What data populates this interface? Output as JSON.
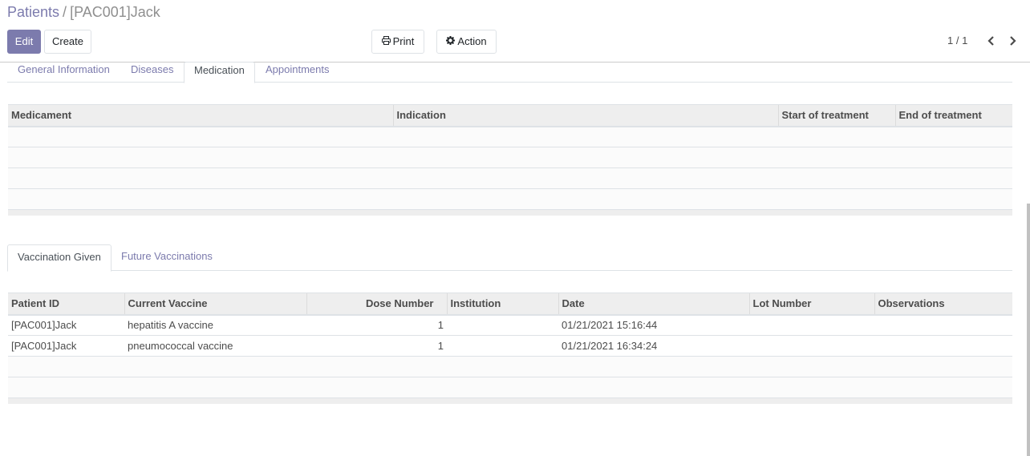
{
  "breadcrumb": {
    "parent": "Patients",
    "separator": "/",
    "current": "[PAC001]Jack"
  },
  "buttons": {
    "edit": "Edit",
    "create": "Create",
    "print": "Print",
    "action": "Action"
  },
  "pager": {
    "value": "1 / 1"
  },
  "icons": {
    "print": "print-icon",
    "action": "gear-icon",
    "prev": "chevron-left-icon",
    "next": "chevron-right-icon"
  },
  "colors": {
    "accent": "#7c7bad",
    "header_bg": "#eeeeee",
    "text": "#4c4c4c"
  },
  "main_tabs": [
    {
      "label": "General Information",
      "active": false
    },
    {
      "label": "Diseases",
      "active": false
    },
    {
      "label": "Medication",
      "active": true
    },
    {
      "label": "Appointments",
      "active": false
    }
  ],
  "medication_table": {
    "columns": [
      "Medicament",
      "Indication",
      "Start of treatment",
      "End of treatment"
    ],
    "rows": []
  },
  "vaccination_tabs": [
    {
      "label": "Vaccination Given",
      "active": true
    },
    {
      "label": "Future Vaccinations",
      "active": false
    }
  ],
  "vaccination_table": {
    "columns": [
      "Patient ID",
      "Current Vaccine",
      "Dose Number",
      "Institution",
      "Date",
      "Lot Number",
      "Observations"
    ],
    "rows": [
      {
        "patient_id": "[PAC001]Jack",
        "vaccine": "hepatitis A vaccine",
        "dose": "1",
        "institution": "",
        "date": "01/21/2021 15:16:44",
        "lot": "",
        "observations": ""
      },
      {
        "patient_id": "[PAC001]Jack",
        "vaccine": "pneumococcal vaccine",
        "dose": "1",
        "institution": "",
        "date": "01/21/2021 16:34:24",
        "lot": "",
        "observations": ""
      }
    ]
  }
}
